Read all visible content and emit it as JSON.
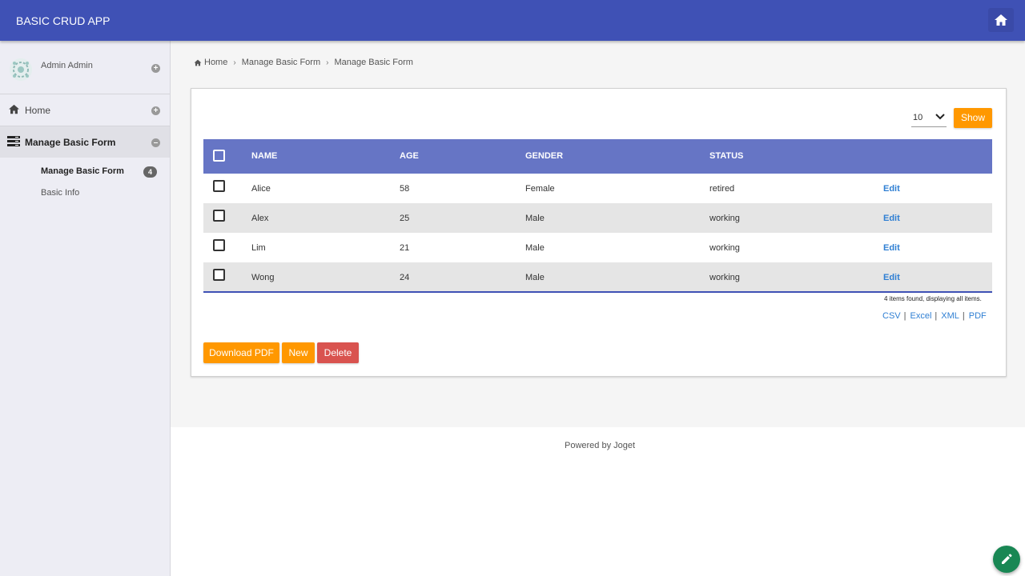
{
  "header": {
    "title": "BASIC CRUD APP",
    "home_icon": "home-icon",
    "color": "#3f51b5"
  },
  "sidebar": {
    "user": {
      "name": "Admin Admin"
    },
    "items": [
      {
        "label": "Home",
        "icon": "home-icon"
      },
      {
        "label": "Manage Basic Form",
        "icon": "list-icon",
        "expanded": true,
        "children": [
          {
            "label": "Manage Basic Form",
            "count": "4",
            "active": true
          },
          {
            "label": "Basic Info"
          }
        ]
      }
    ]
  },
  "breadcrumb": [
    "Home",
    "Manage Basic Form",
    "Manage Basic Form"
  ],
  "list": {
    "page_size": "10",
    "show_label": "Show",
    "columns": [
      "NAME",
      "AGE",
      "GENDER",
      "STATUS"
    ],
    "rows": [
      {
        "name": "Alice",
        "age": "58",
        "gender": "Female",
        "status": "retired",
        "action": "Edit"
      },
      {
        "name": "Alex",
        "age": "25",
        "gender": "Male",
        "status": "working",
        "action": "Edit"
      },
      {
        "name": "Lim",
        "age": "21",
        "gender": "Male",
        "status": "working",
        "action": "Edit"
      },
      {
        "name": "Wong",
        "age": "24",
        "gender": "Male",
        "status": "working",
        "action": "Edit"
      }
    ],
    "found_text": "4 items found, displaying all items.",
    "exports": [
      "CSV",
      "Excel",
      "XML",
      "PDF"
    ],
    "buttons": {
      "download": "Download PDF",
      "new": "New",
      "delete": "Delete"
    }
  },
  "footer": {
    "text": "Powered by Joget"
  },
  "colors": {
    "accent": "#ff9800",
    "danger": "#d9534f",
    "table_header": "#6675c5",
    "link": "#2f7fd3",
    "fab": "#198754"
  }
}
